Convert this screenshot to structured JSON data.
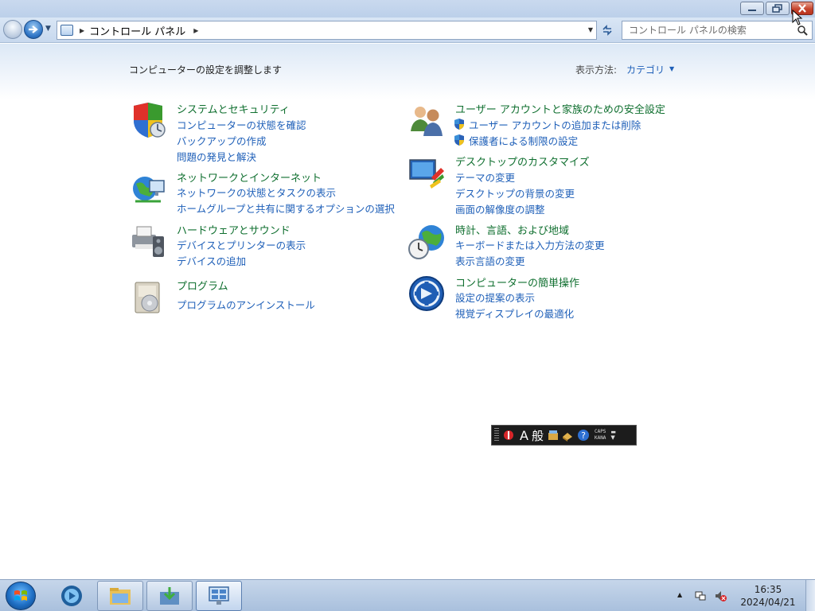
{
  "window": {
    "caption": {
      "minimize": "minimize",
      "maximize": "restore",
      "close": "close"
    }
  },
  "address_bar": {
    "path": "コントロール パネル"
  },
  "search": {
    "placeholder": "コントロール パネルの検索"
  },
  "header": {
    "subtitle": "コンピューターの設定を調整します",
    "view_by_label": "表示方法:",
    "view_by_value": "カテゴリ"
  },
  "categories": [
    {
      "title": "システムとセキュリティ",
      "icon": "security-shield-icon",
      "links": [
        "コンピューターの状態を確認",
        "バックアップの作成",
        "問題の発見と解決"
      ]
    },
    {
      "title": "ネットワークとインターネット",
      "icon": "network-globe-icon",
      "links": [
        "ネットワークの状態とタスクの表示",
        "ホームグループと共有に関するオプションの選択"
      ]
    },
    {
      "title": "ハードウェアとサウンド",
      "icon": "printer-speaker-icon",
      "links": [
        "デバイスとプリンターの表示",
        "デバイスの追加"
      ]
    },
    {
      "title": "プログラム",
      "icon": "program-disc-icon",
      "links": [
        "プログラムのアンインストール"
      ]
    },
    {
      "title": "ユーザー アカウントと家族のための安全設定",
      "icon": "users-icon",
      "links": [
        "ユーザー アカウントの追加または削除",
        "保護者による制限の設定"
      ]
    },
    {
      "title": "デスクトップのカスタマイズ",
      "icon": "desktop-personalize-icon",
      "links": [
        "テーマの変更",
        "デスクトップの背景の変更",
        "画面の解像度の調整"
      ]
    },
    {
      "title": "時計、言語、および地域",
      "icon": "clock-globe-icon",
      "links": [
        "キーボードまたは入力方法の変更",
        "表示言語の変更"
      ]
    },
    {
      "title": "コンピューターの簡単操作",
      "icon": "ease-of-access-icon",
      "links": [
        "設定の提案の表示",
        "視覚ディスプレイの最適化"
      ]
    }
  ],
  "ime_bar": {
    "mode": "A",
    "conversion": "般",
    "caps": "CAPS",
    "kana": "KANA"
  },
  "taskbar": {
    "items": [
      "start-button",
      "media-player",
      "explorer",
      "downloads",
      "control-panel"
    ],
    "clock_time": "16:35",
    "clock_date": "2024/04/21"
  },
  "colors": {
    "link": "#1e5fb8",
    "category_title": "#0f6f2f",
    "taskbar": "#b4c8e2"
  }
}
